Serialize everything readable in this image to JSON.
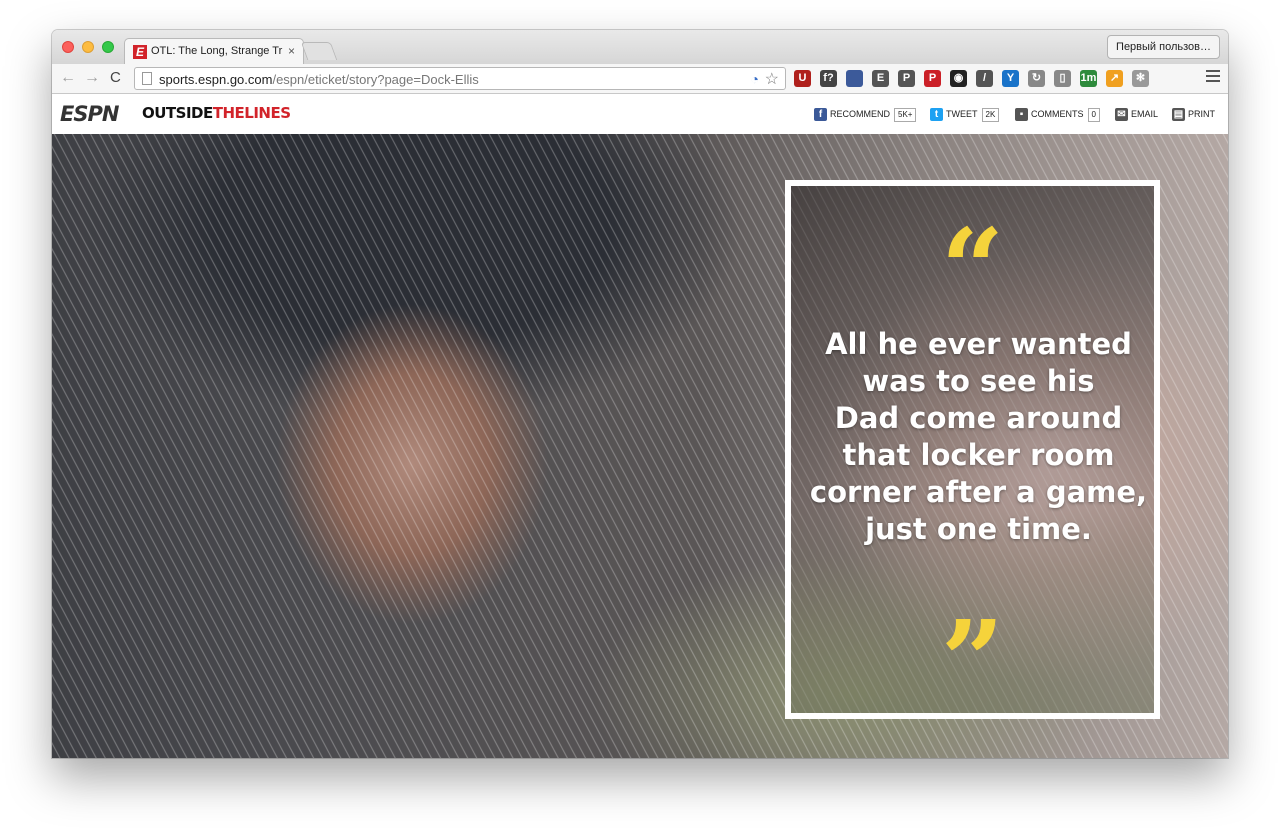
{
  "browser": {
    "tab_title": "OTL: The Long, Strange Tr",
    "tab_close": "×",
    "profile_button": "Первый пользов…",
    "url_domain": "sports.espn.go.com",
    "url_path": "/espn/eticket/story?page=Dock-Ellis",
    "nav": {
      "back": "←",
      "forward": "→",
      "reload": "C"
    },
    "extensions": [
      {
        "name": "ublock-icon",
        "glyph": "U",
        "color": "#b0201c"
      },
      {
        "name": "font-icon",
        "glyph": "f?",
        "color": "#444444"
      },
      {
        "name": "flag-icon",
        "glyph": "",
        "color": "#3c5a9a"
      },
      {
        "name": "evernote-icon",
        "glyph": "E",
        "color": "#555555"
      },
      {
        "name": "pocket-icon",
        "glyph": "P",
        "color": "#555555"
      },
      {
        "name": "pinterest-icon",
        "glyph": "P",
        "color": "#cb2027"
      },
      {
        "name": "camera-icon",
        "glyph": "◉",
        "color": "#222222"
      },
      {
        "name": "eyedropper-icon",
        "glyph": "/",
        "color": "#555555"
      },
      {
        "name": "y-icon",
        "glyph": "Y",
        "color": "#1a73c9"
      },
      {
        "name": "refresh-ext-icon",
        "glyph": "↻",
        "color": "#888888"
      },
      {
        "name": "reader-icon",
        "glyph": "▯",
        "color": "#888888"
      },
      {
        "name": "timer-icon",
        "glyph": "1m",
        "color": "#2e8b3c"
      },
      {
        "name": "analytics-icon",
        "glyph": "↗",
        "color": "#f0a020"
      },
      {
        "name": "paw-icon",
        "glyph": "✻",
        "color": "#999999"
      }
    ]
  },
  "site": {
    "espn_logo": "ESPN",
    "otl_logo_a": "OUTSIDE",
    "otl_logo_b": "THE",
    "otl_logo_c": "LINES",
    "share": {
      "recommend_label": "RECOMMEND",
      "recommend_count": "5K+",
      "tweet_label": "TWEET",
      "tweet_count": "2K",
      "comments_label": "COMMENTS",
      "comments_count": "0",
      "email_label": "EMAIL",
      "print_label": "PRINT"
    }
  },
  "hero": {
    "open_quote": "“",
    "close_quote": "”",
    "quote_lines": [
      "All he ever wanted",
      "was to see his",
      "Dad come around",
      "that locker room",
      "corner after a game,",
      "just one time."
    ]
  }
}
